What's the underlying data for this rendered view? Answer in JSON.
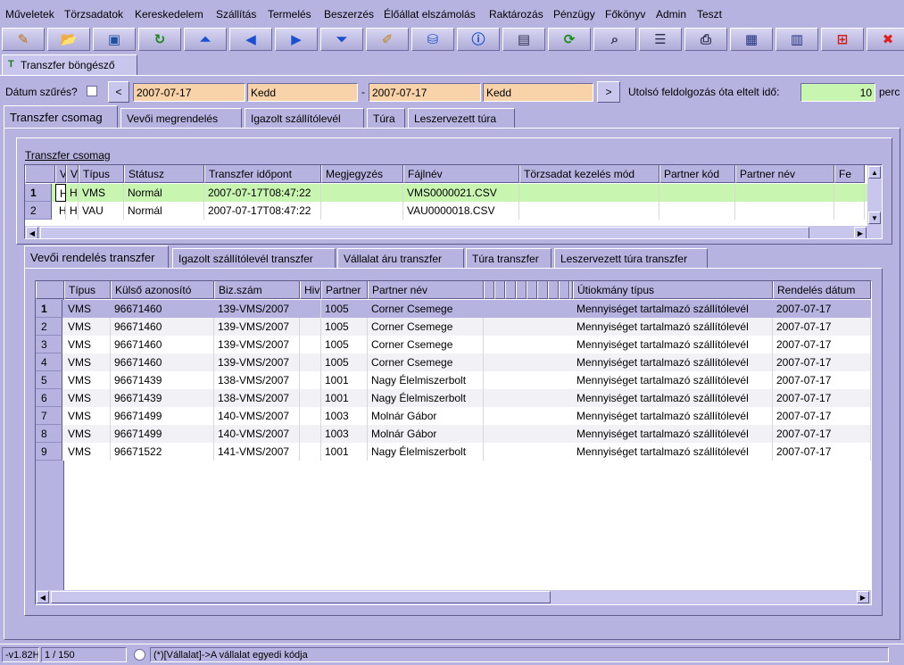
{
  "menu": [
    "Műveletek",
    "Törzsadatok",
    "Kereskedelem",
    "Szállítás",
    "Termelés",
    "Beszerzés",
    "Élőállat elszámolás",
    "Raktározás",
    "Pénzügy",
    "Főkönyv",
    "Admin",
    "Teszt"
  ],
  "toolbar_icons": [
    "edit-icon",
    "open-folder-icon",
    "save-icon",
    "refresh-arrow-icon",
    "first-record-icon",
    "previous-icon",
    "next-icon",
    "last-record-icon",
    "note-icon",
    "database-icon",
    "info-icon",
    "window-icon",
    "reload-icon",
    "search-icon",
    "columns-icon",
    "print-icon",
    "grid-export-icon",
    "grid-import-icon",
    "settings-icon",
    "close-icon"
  ],
  "window_tab": "Transzfer böngésző",
  "filter": {
    "date_filter_label": "Dátum szűrés?",
    "prev": "<",
    "next": ">",
    "from_date": "2007-07-17",
    "from_day": "Kedd",
    "dash": "-",
    "to_date": "2007-07-17",
    "to_day": "Kedd",
    "elapsed_label": "Utolsó feldolgozás óta eltelt idő:",
    "elapsed_value": "10",
    "elapsed_unit": "perc"
  },
  "main_tabs": [
    "Transzfer csomag",
    "Vevői megrendelés",
    "Igazolt szállítólevél",
    "Túra",
    "Leszervezett túra"
  ],
  "package": {
    "title": "Transzfer csomag",
    "headers": [
      "Va",
      "V",
      "Típus",
      "Státusz",
      "Transzfer időpont",
      "Megjegyzés",
      "Fájlnév",
      "Törzsadat kezelés mód",
      "Partner kód",
      "Partner név",
      "Fe"
    ],
    "rows": [
      {
        "num": "1",
        "va": "H",
        "v": "H",
        "tipus": "VMS",
        "statusz": "Normál",
        "idopont": "2007-07-17T08:47:22",
        "megj": "",
        "fajl": "VMS0000021.CSV"
      },
      {
        "num": "2",
        "va": "H",
        "v": "H",
        "tipus": "VAU",
        "statusz": "Normál",
        "idopont": "2007-07-17T08:47:22",
        "megj": "",
        "fajl": "VAU0000018.CSV"
      }
    ]
  },
  "sub_tabs": [
    "Vevői rendelés transzfer",
    "Igazolt szállítólevél transzfer",
    "Vállalat áru transzfer",
    "Túra transzfer",
    "Leszervezett túra transzfer"
  ],
  "orders": {
    "headers": [
      "Típus",
      "Külső azonosító",
      "Biz.szám",
      "Hiv",
      "Partner",
      "Partner név",
      "Útiokmány típus",
      "Rendelés dátum"
    ],
    "rows": [
      [
        "1",
        "VMS",
        "96671460",
        "139-VMS/2007",
        "1005",
        "Corner Csemege",
        "Mennyiséget tartalmazó szállítólevél",
        "2007-07-17"
      ],
      [
        "2",
        "VMS",
        "96671460",
        "139-VMS/2007",
        "1005",
        "Corner Csemege",
        "Mennyiséget tartalmazó szállítólevél",
        "2007-07-17"
      ],
      [
        "3",
        "VMS",
        "96671460",
        "139-VMS/2007",
        "1005",
        "Corner Csemege",
        "Mennyiséget tartalmazó szállítólevél",
        "2007-07-17"
      ],
      [
        "4",
        "VMS",
        "96671460",
        "139-VMS/2007",
        "1005",
        "Corner Csemege",
        "Mennyiséget tartalmazó szállítólevél",
        "2007-07-17"
      ],
      [
        "5",
        "VMS",
        "96671439",
        "138-VMS/2007",
        "1001",
        "Nagy Élelmiszerbolt",
        "Mennyiséget tartalmazó szállítólevél",
        "2007-07-17"
      ],
      [
        "6",
        "VMS",
        "96671439",
        "138-VMS/2007",
        "1001",
        "Nagy Élelmiszerbolt",
        "Mennyiséget tartalmazó szállítólevél",
        "2007-07-17"
      ],
      [
        "7",
        "VMS",
        "96671499",
        "140-VMS/2007",
        "1003",
        "Molnár Gábor",
        "Mennyiséget tartalmazó szállítólevél",
        "2007-07-17"
      ],
      [
        "8",
        "VMS",
        "96671499",
        "140-VMS/2007",
        "1003",
        "Molnár Gábor",
        "Mennyiséget tartalmazó szállítólevél",
        "2007-07-17"
      ],
      [
        "9",
        "VMS",
        "96671522",
        "141-VMS/2007",
        "1001",
        "Nagy Élelmiszerbolt",
        "Mennyiséget tartalmazó szállítólevél",
        "2007-07-17"
      ]
    ]
  },
  "status": {
    "version": "-v1.82H",
    "record": "1 / 150",
    "hint": "(*)[Vállalat]->A vállalat egyedi kódja"
  },
  "colors": {
    "background": "#b6b3e0",
    "selected_row": "#c8f5b0",
    "peach_field": "#f8d2a8"
  }
}
